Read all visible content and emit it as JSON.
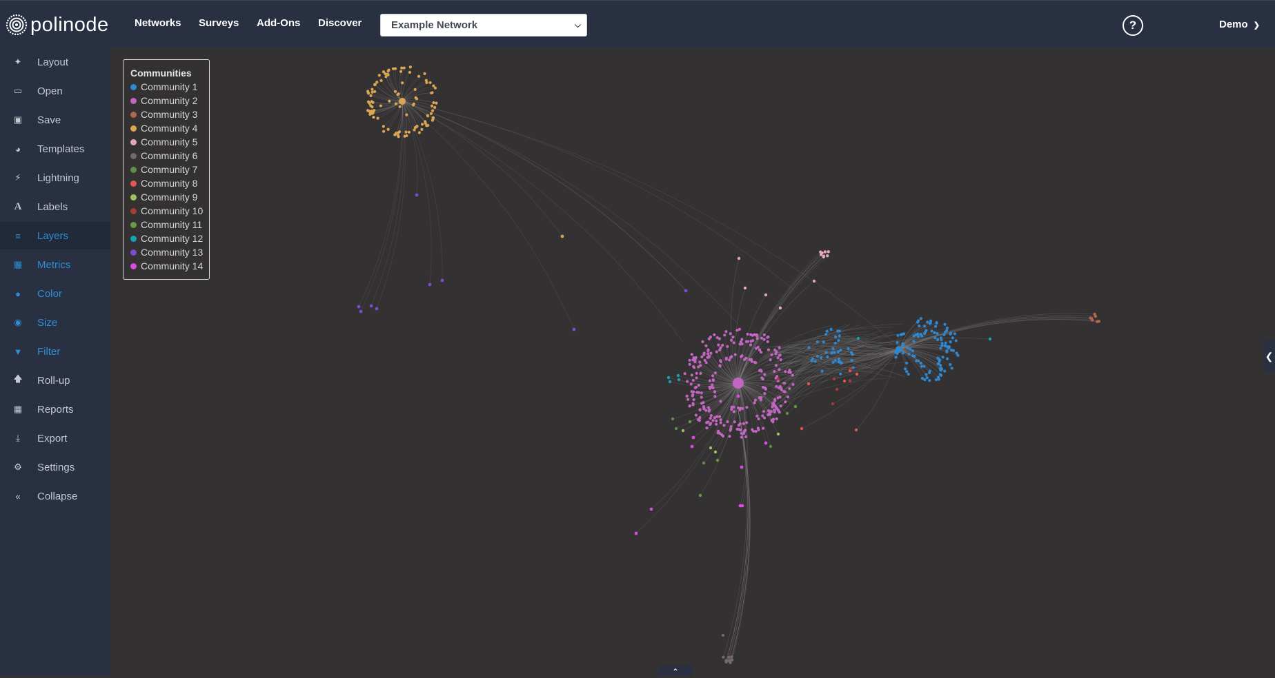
{
  "app": {
    "brand": "polinode"
  },
  "nav": {
    "links": [
      "Networks",
      "Surveys",
      "Add-Ons",
      "Discover"
    ],
    "network_select": {
      "value": "Example Network"
    },
    "user": "Demo"
  },
  "sidebar": {
    "items": [
      {
        "label": "Layout",
        "icon": "magic-wand-icon"
      },
      {
        "label": "Open",
        "icon": "folder-open-icon"
      },
      {
        "label": "Save",
        "icon": "floppy-disk-icon"
      },
      {
        "label": "Templates",
        "icon": "palette-icon"
      },
      {
        "label": "Lightning",
        "icon": "lightning-bolt-icon"
      },
      {
        "label": "Labels",
        "icon": "font-icon"
      },
      {
        "label": "Layers",
        "icon": "layers-icon",
        "active": true
      },
      {
        "label": "Metrics",
        "icon": "calculator-icon"
      },
      {
        "label": "Color",
        "icon": "color-drop-icon"
      },
      {
        "label": "Size",
        "icon": "size-target-icon"
      },
      {
        "label": "Filter",
        "icon": "filter-funnel-icon"
      },
      {
        "label": "Roll-up",
        "icon": "arrow-up-icon"
      },
      {
        "label": "Reports",
        "icon": "table-grid-icon"
      },
      {
        "label": "Export",
        "icon": "download-icon"
      },
      {
        "label": "Settings",
        "icon": "gear-icon"
      },
      {
        "label": "Collapse",
        "icon": "double-chevron-left-icon"
      }
    ]
  },
  "legend": {
    "title": "Communities",
    "items": [
      {
        "label": "Community 1",
        "color": "#2f88d0"
      },
      {
        "label": "Community 2",
        "color": "#c266c2"
      },
      {
        "label": "Community 3",
        "color": "#b0674f"
      },
      {
        "label": "Community 4",
        "color": "#dba552"
      },
      {
        "label": "Community 5",
        "color": "#e3a9b8"
      },
      {
        "label": "Community 6",
        "color": "#74686c"
      },
      {
        "label": "Community 7",
        "color": "#5f8f46"
      },
      {
        "label": "Community 8",
        "color": "#e2574f"
      },
      {
        "label": "Community 9",
        "color": "#9fc65e"
      },
      {
        "label": "Community 10",
        "color": "#a63c3a"
      },
      {
        "label": "Community 11",
        "color": "#6b9a46"
      },
      {
        "label": "Community 12",
        "color": "#16a2b0"
      },
      {
        "label": "Community 13",
        "color": "#7d4ad1"
      },
      {
        "label": "Community 14",
        "color": "#d84be0"
      }
    ]
  }
}
